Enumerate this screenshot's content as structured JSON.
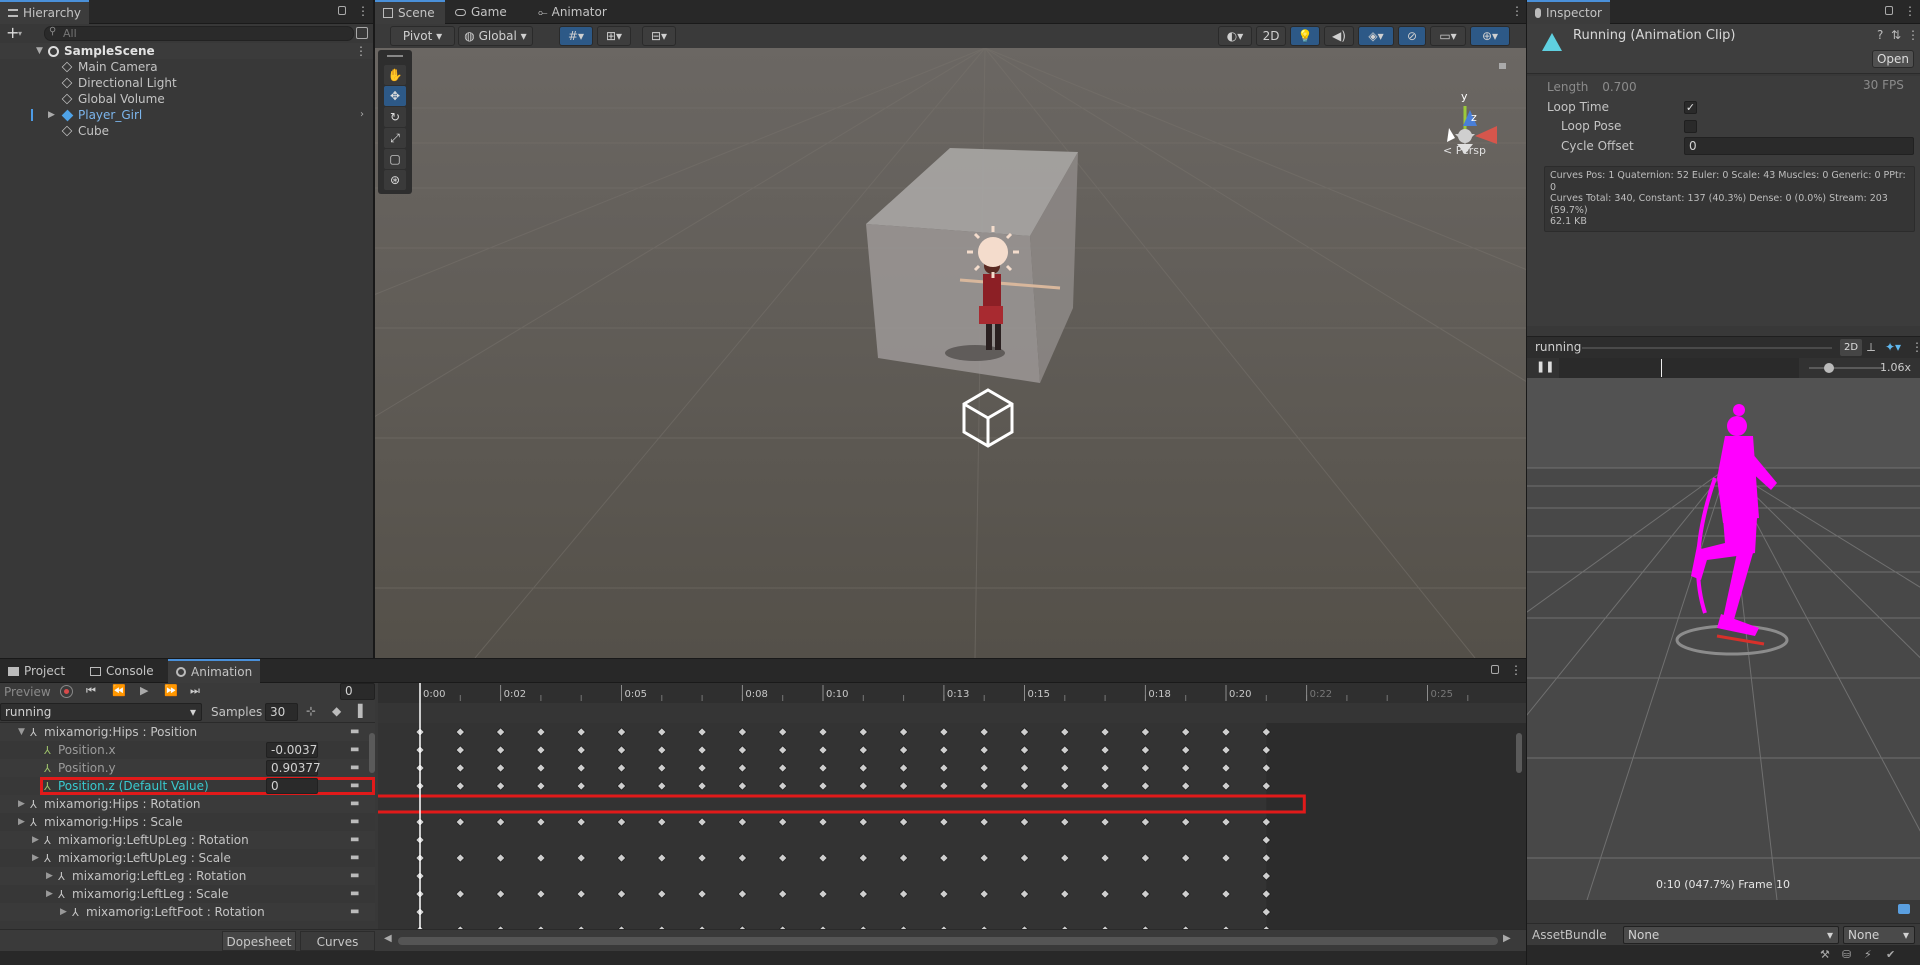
{
  "hierarchy": {
    "tab": "Hierarchy",
    "add_label": "+",
    "search_placeholder": "All",
    "scene_name": "SampleScene",
    "items": [
      {
        "label": "Main Camera",
        "selected": false
      },
      {
        "label": "Directional Light",
        "selected": false
      },
      {
        "label": "Global Volume",
        "selected": false
      },
      {
        "label": "Player_Girl",
        "selected": true
      },
      {
        "label": "Cube",
        "selected": false
      }
    ]
  },
  "scene": {
    "tabs": [
      "Scene",
      "Game",
      "Animator"
    ],
    "pivot_label": "Pivot",
    "global_label": "Global",
    "mode_2d": "2D",
    "persp_label": "Persp",
    "gizmo_y": "y",
    "gizmo_z": "z",
    "tools": [
      "hand",
      "move",
      "rotate",
      "scale",
      "rect",
      "transform"
    ]
  },
  "inspector": {
    "tab": "Inspector",
    "title": "Running (Animation Clip)",
    "open_label": "Open",
    "length_label": "Length",
    "length_value": "0.700",
    "fps_value": "30 FPS",
    "loop_time_label": "Loop Time",
    "loop_time_checked": true,
    "loop_pose_label": "Loop Pose",
    "loop_pose_checked": false,
    "cycle_offset_label": "Cycle Offset",
    "cycle_offset_value": "0",
    "info_line1": "Curves Pos: 1 Quaternion: 52 Euler: 0 Scale: 43 Muscles: 0 Generic: 0 PPtr: 0",
    "info_line2": "Curves Total: 340, Constant: 137 (40.3%) Dense: 0 (0.0%) Stream: 203 (59.7%)",
    "info_line3": "62.1 KB",
    "preview_title": "running",
    "preview_2d": "2D",
    "preview_speed": "1.06x",
    "preview_status": "0:10 (047.7%) Frame 10",
    "assetbundle_label": "AssetBundle",
    "assetbundle_value": "None",
    "variant_value": "None"
  },
  "animation": {
    "tabs": [
      "Project",
      "Console",
      "Animation"
    ],
    "preview_label": "Preview",
    "frame_value": "0",
    "clip_name": "running",
    "samples_label": "Samples",
    "samples_value": "30",
    "ruler_labels": [
      "0:00",
      "0:02",
      "0:05",
      "0:08",
      "0:10",
      "0:13",
      "0:15",
      "0:18",
      "0:20",
      "0:22",
      "0:25"
    ],
    "properties": [
      {
        "label": "mixamorig:Hips : Position",
        "value": "",
        "indent": 0,
        "expanded": true,
        "highlight": false
      },
      {
        "label": "Position.x",
        "value": "-0.0037",
        "indent": 1,
        "expanded": false,
        "highlight": false
      },
      {
        "label": "Position.y",
        "value": "0.90377",
        "indent": 1,
        "expanded": false,
        "highlight": false
      },
      {
        "label": "Position.z (Default Value)",
        "value": "0",
        "indent": 1,
        "expanded": false,
        "highlight": true
      },
      {
        "label": "mixamorig:Hips : Rotation",
        "value": "",
        "indent": 0,
        "expanded": false,
        "highlight": false
      },
      {
        "label": "mixamorig:Hips : Scale",
        "value": "",
        "indent": 0,
        "expanded": false,
        "highlight": false
      },
      {
        "label": "mixamorig:LeftUpLeg : Rotation",
        "value": "",
        "indent": 1,
        "expanded": false,
        "highlight": false
      },
      {
        "label": "mixamorig:LeftUpLeg : Scale",
        "value": "",
        "indent": 1,
        "expanded": false,
        "highlight": false
      },
      {
        "label": "mixamorig:LeftLeg : Rotation",
        "value": "",
        "indent": 2,
        "expanded": false,
        "highlight": false
      },
      {
        "label": "mixamorig:LeftLeg : Scale",
        "value": "",
        "indent": 2,
        "expanded": false,
        "highlight": false
      },
      {
        "label": "mixamorig:LeftFoot : Rotation",
        "value": "",
        "indent": 3,
        "expanded": false,
        "highlight": false
      }
    ],
    "dopesheet_label": "Dopesheet",
    "curves_label": "Curves"
  }
}
